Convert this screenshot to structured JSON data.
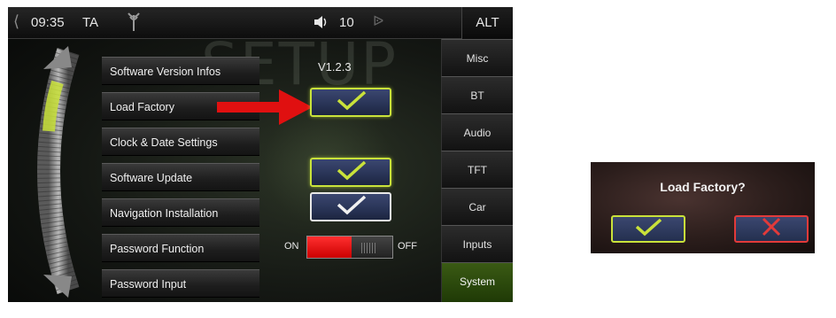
{
  "status_bar": {
    "back_icon": "back-arrow-icon",
    "time": "09:35",
    "traffic_announcement": "TA",
    "antenna_icon": "antenna-icon",
    "speaker_icon": "speaker-icon",
    "volume": "10",
    "bluetooth_icon": "bluetooth-icon",
    "mode_button": "ALT"
  },
  "watermark": "SETUP",
  "menu": {
    "items": [
      {
        "label": "Software Version Infos"
      },
      {
        "label": "Load Factory"
      },
      {
        "label": "Clock & Date Settings"
      },
      {
        "label": "Software Update"
      },
      {
        "label": "Navigation Installation"
      },
      {
        "label": "Password Function"
      },
      {
        "label": "Password Input"
      }
    ]
  },
  "software_version": "V1.2.3",
  "password_toggle": {
    "on_label": "ON",
    "off_label": "OFF",
    "state": "ON"
  },
  "tabs": [
    {
      "label": "Misc"
    },
    {
      "label": "BT"
    },
    {
      "label": "Audio"
    },
    {
      "label": "TFT"
    },
    {
      "label": "Car"
    },
    {
      "label": "Inputs"
    },
    {
      "label": "System",
      "active": true
    }
  ],
  "dialog": {
    "title": "Load Factory?",
    "confirm_icon": "checkmark-icon",
    "cancel_icon": "cross-icon"
  },
  "colors": {
    "accent_green": "#c9e23a",
    "arrow_red": "#e01010",
    "toggle_red": "#ff3030",
    "button_blue": "#2a3558"
  }
}
